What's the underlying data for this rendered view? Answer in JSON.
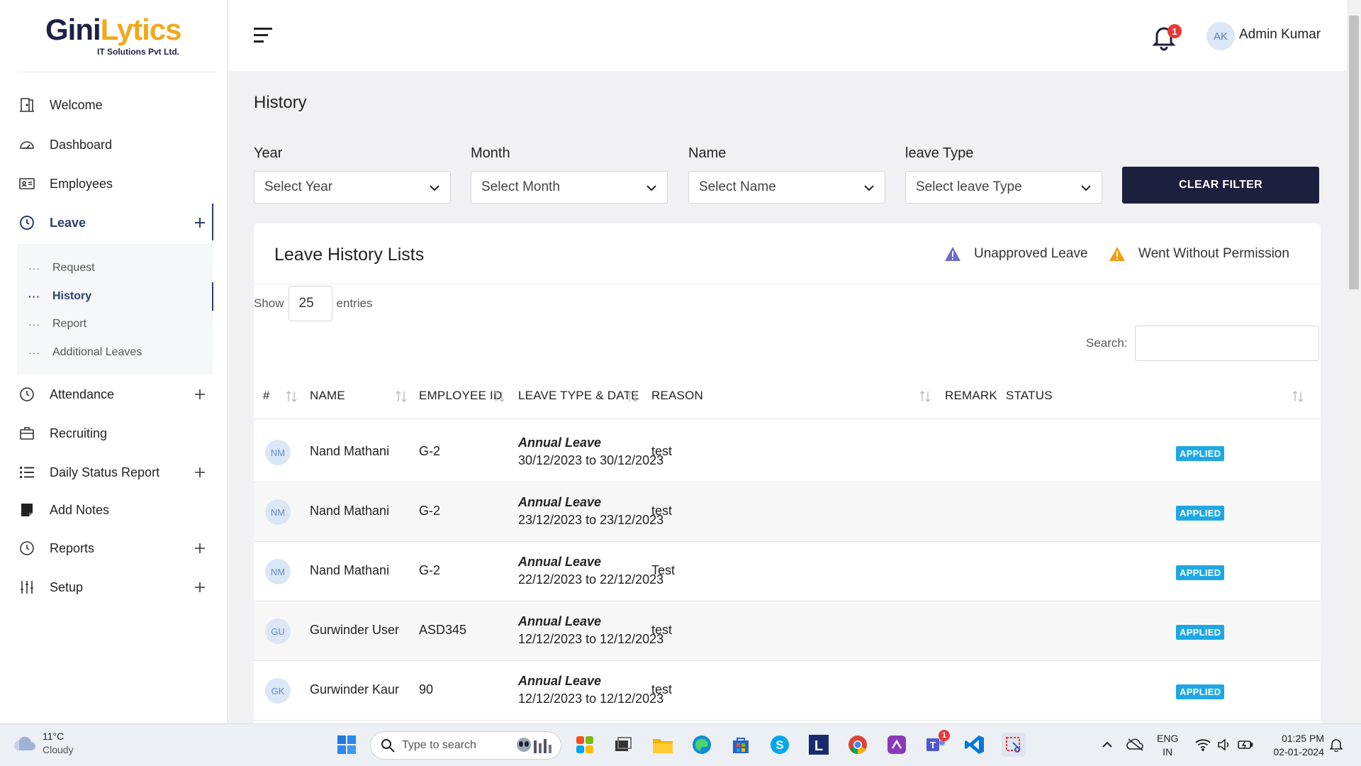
{
  "brand": {
    "name_part1": "Gini",
    "name_part2": "Lytics",
    "subtitle": "IT Solutions Pvt Ltd."
  },
  "sidebar": {
    "items": [
      {
        "label": "Welcome",
        "icon": "door-icon"
      },
      {
        "label": "Dashboard",
        "icon": "gauge-icon"
      },
      {
        "label": "Employees",
        "icon": "id-card-icon"
      },
      {
        "label": "Leave",
        "icon": "clock-icon",
        "expandable": true,
        "active": true
      },
      {
        "label": "Attendance",
        "icon": "clock-icon",
        "expandable": true
      },
      {
        "label": "Recruiting",
        "icon": "briefcase-icon"
      },
      {
        "label": "Daily Status Report",
        "icon": "list-icon",
        "expandable": true
      },
      {
        "label": "Add Notes",
        "icon": "note-icon"
      },
      {
        "label": "Reports",
        "icon": "clock-icon",
        "expandable": true
      },
      {
        "label": "Setup",
        "icon": "sliders-icon",
        "expandable": true
      }
    ],
    "leave_submenu": [
      {
        "label": "Request"
      },
      {
        "label": "History",
        "active": true
      },
      {
        "label": "Report"
      },
      {
        "label": "Additional Leaves"
      }
    ]
  },
  "topbar": {
    "notification_count": "1",
    "user_initials": "AK",
    "user_name": "Admin Kumar"
  },
  "page": {
    "title": "History"
  },
  "filters": [
    {
      "label": "Year",
      "value": "Select Year"
    },
    {
      "label": "Month",
      "value": "Select Month"
    },
    {
      "label": "Name",
      "value": "Select Name"
    },
    {
      "label": "leave Type",
      "value": "Select leave Type"
    }
  ],
  "clear_filter_label": "CLEAR FILTER",
  "card": {
    "title": "Leave History Lists",
    "legend": [
      {
        "label": "Unapproved Leave",
        "color": "#6b6bc9"
      },
      {
        "label": "Went Without Permission",
        "color": "#f39c12"
      }
    ],
    "show_label": "Show",
    "entries_value": "25",
    "entries_label": "entries",
    "search_label": "Search:",
    "search_value": ""
  },
  "table": {
    "columns": [
      "#",
      "NAME",
      "EMPLOYEE ID",
      "LEAVE TYPE & DATE",
      "REASON",
      "REMARK",
      "STATUS"
    ],
    "rows": [
      {
        "initials": "NM",
        "name": "Nand Mathani",
        "emp_id": "G-2",
        "leave_type": "Annual Leave",
        "dates": "30/12/2023 to 30/12/2023",
        "reason": "test",
        "remark": "",
        "status": "APPLIED"
      },
      {
        "initials": "NM",
        "name": "Nand Mathani",
        "emp_id": "G-2",
        "leave_type": "Annual Leave",
        "dates": "23/12/2023 to 23/12/2023",
        "reason": "test",
        "remark": "",
        "status": "APPLIED"
      },
      {
        "initials": "NM",
        "name": "Nand Mathani",
        "emp_id": "G-2",
        "leave_type": "Annual Leave",
        "dates": "22/12/2023 to 22/12/2023",
        "reason": "Test",
        "remark": "",
        "status": "APPLIED"
      },
      {
        "initials": "GU",
        "name": "Gurwinder User",
        "emp_id": "ASD345",
        "leave_type": "Annual Leave",
        "dates": "12/12/2023 to 12/12/2023",
        "reason": "test",
        "remark": "",
        "status": "APPLIED"
      },
      {
        "initials": "GK",
        "name": "Gurwinder Kaur",
        "emp_id": "90",
        "leave_type": "Annual Leave",
        "dates": "12/12/2023 to 12/12/2023",
        "reason": "test",
        "remark": "",
        "status": "APPLIED"
      }
    ]
  },
  "taskbar": {
    "weather_temp": "11°C",
    "weather_cond": "Cloudy",
    "search_placeholder": "Type to search",
    "teams_badge": "1",
    "lang_line1": "ENG",
    "lang_line2": "IN",
    "time": "01:25 PM",
    "date": "02-01-2024"
  }
}
